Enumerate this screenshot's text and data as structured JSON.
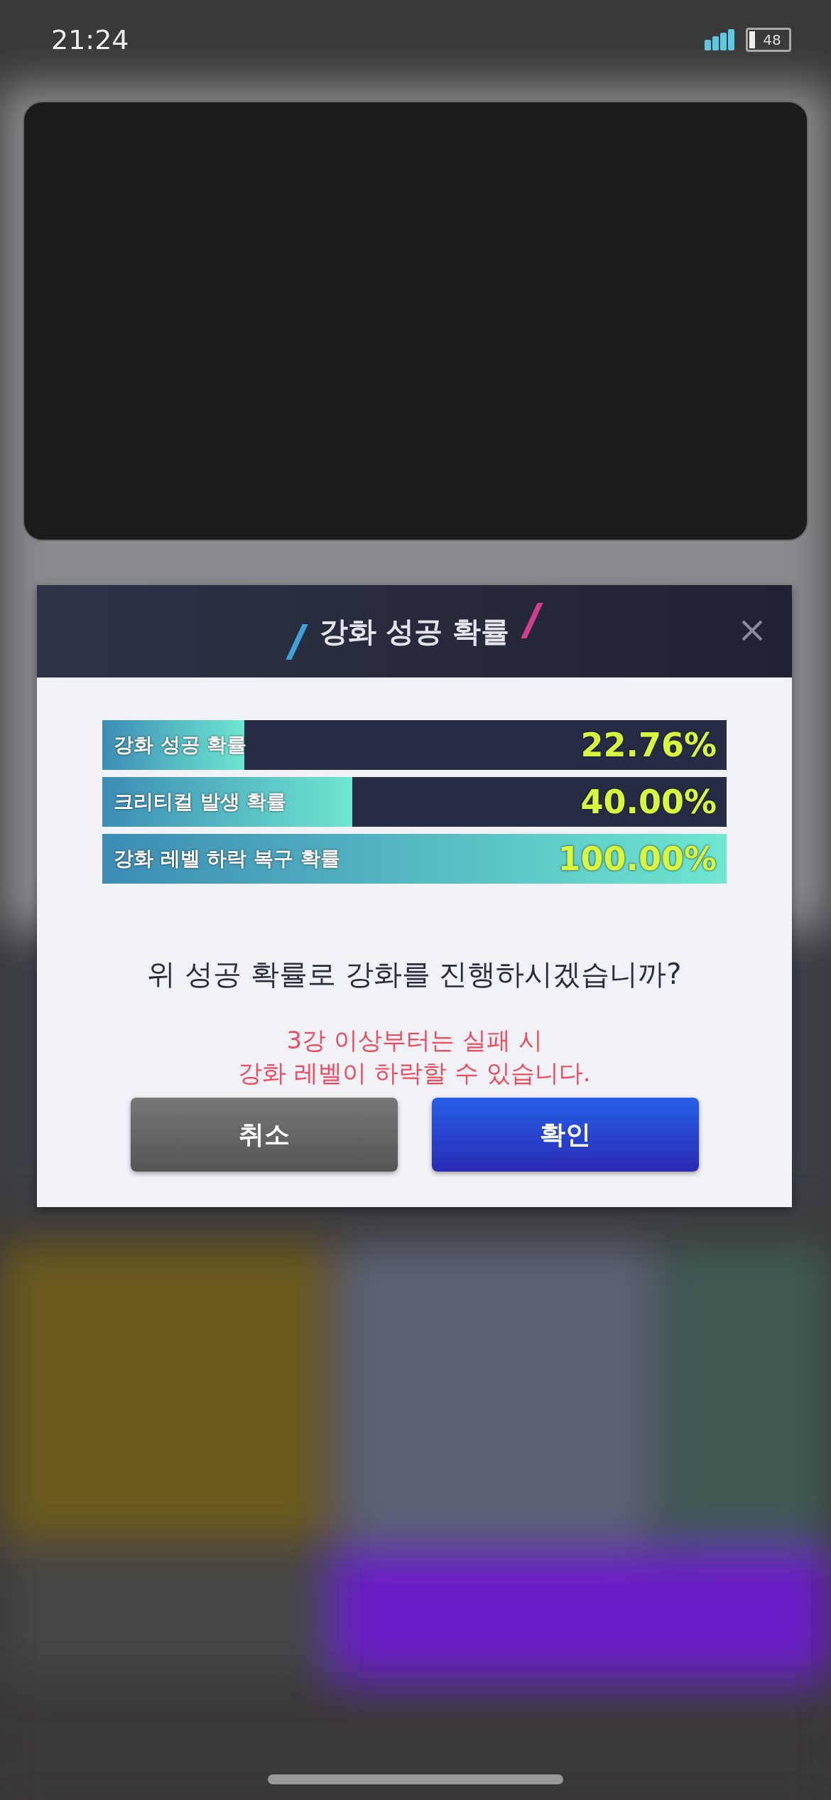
{
  "status_bar": {
    "time": "21:24",
    "battery": "48"
  },
  "dialog": {
    "title": "강화 성공 확률",
    "rates": [
      {
        "label": "강화 성공 확률",
        "value": "22.76%",
        "level": 0.2276
      },
      {
        "label": "크리티컬 발생 확률",
        "value": "40.00%",
        "level": 0.4
      },
      {
        "label": "강화 레벨 하락 복구 확률",
        "value": "100.00%",
        "level": 1
      }
    ],
    "question": "위 성공 확률로 강화를 진행하시겠습니까?",
    "warning": [
      "3강 이상부터는 실패 시",
      "강화 레벨이 하락할 수 있습니다."
    ],
    "buttons": [
      {
        "label": "취소",
        "kind": "cancel"
      },
      {
        "label": "확인",
        "kind": "confirm"
      }
    ]
  }
}
